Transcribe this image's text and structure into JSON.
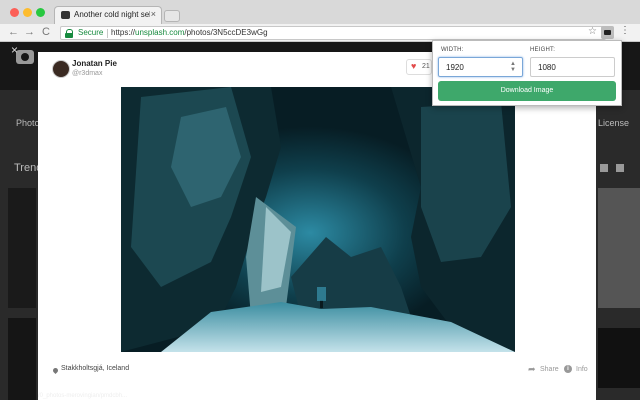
{
  "browser": {
    "tab_title": "Another cold night selfie photo",
    "tab_close": "×",
    "nav": {
      "back": "←",
      "forward": "→",
      "reload": "C"
    },
    "security_label": "Secure",
    "url_scheme": "https://",
    "url_host": "unsplash.com",
    "url_path": "/photos/3N5ccDE3wGg",
    "star": "☆",
    "menu": "⋮"
  },
  "background_page": {
    "close": "×",
    "nav_left": "Photo c",
    "nav_right": "License",
    "trending": "Trendin",
    "status_link": "/0_photos-merovingian/pmdcbh..."
  },
  "photo_modal": {
    "author_name": "Jonatan Pie",
    "author_handle": "@r3dmax",
    "like_count": "21",
    "location": "Stakkholtsgjá, Iceland",
    "share": "Share",
    "info": "Info",
    "info_icon_glyph": "i"
  },
  "extension_popup": {
    "width_label": "WIDTH:",
    "width_value": "1920",
    "height_label": "HEIGHT:",
    "height_value": "1080",
    "download_label": "Download Image"
  },
  "colors": {
    "secure_green": "#168a3e",
    "download_green": "#3ea86b",
    "like_red": "#e24b4b"
  }
}
